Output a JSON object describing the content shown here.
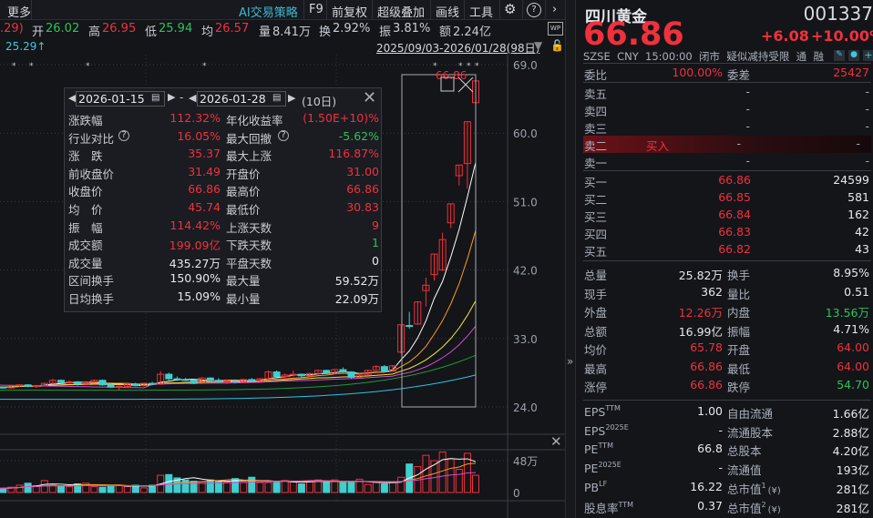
{
  "toolbar": {
    "more": "更多",
    "ai": "AI交易策略",
    "f9": "F9",
    "adjust": "前复权",
    "overlay": "超级叠加",
    "draw": "画线",
    "tools": "工具"
  },
  "quote": {
    "prev_fragment": ".29)",
    "open_label": "开",
    "open": "26.02",
    "high_label": "高",
    "high": "26.95",
    "low_label": "低",
    "low": "25.94",
    "avg_label": "均",
    "avg": "26.57",
    "vol_label": "量",
    "vol": "8.41万",
    "turn_label": "换",
    "turn": "2.92%",
    "amp_label": "振",
    "amp": "3.81%",
    "amt_label": "额",
    "amt": "2.24亿"
  },
  "range": {
    "ma_value": "25.29↑",
    "date_range": "2025/09/03-2026/01/28(98日)"
  },
  "price_axis": [
    "69.0",
    "60.0",
    "51.0",
    "42.0",
    "33.0",
    "24.0"
  ],
  "volume_axis": [
    "48万",
    "0"
  ],
  "selection": {
    "top_label": "66.86"
  },
  "popup": {
    "start": "2026-01-15",
    "end": "2026-01-28",
    "days": "(10日)",
    "rows": [
      [
        "涨跌幅",
        "112.32%",
        "年化收益率",
        "(1.50E+10)%"
      ],
      [
        "行业对比",
        "16.05%",
        "最大回撤",
        "-5.62%"
      ],
      [
        "涨　跌",
        "35.37",
        "最大上涨",
        "116.87%"
      ],
      [
        "前收盘价",
        "31.49",
        "开盘价",
        "31.00"
      ],
      [
        "收盘价",
        "66.86",
        "最高价",
        "66.86"
      ],
      [
        "均　价",
        "45.74",
        "最低价",
        "30.83"
      ],
      [
        "振　幅",
        "114.42%",
        "上涨天数",
        "9"
      ],
      [
        "成交额",
        "199.09亿",
        "下跌天数",
        "1"
      ],
      [
        "成交量",
        "435.27万",
        "平盘天数",
        "0"
      ],
      [
        "区间换手",
        "150.90%",
        "最大量",
        "59.52万"
      ],
      [
        "日均换手",
        "15.09%",
        "最小量",
        "22.09万"
      ]
    ]
  },
  "stock": {
    "name": "四川黄金",
    "code": "001337",
    "price": "66.86",
    "change": "+6.08",
    "change_pct": "+10.00%",
    "exchange": "SZSE",
    "currency": "CNY",
    "time": "15:00:00",
    "status": "闭市",
    "tag": "疑似减持受限",
    "tong": "通",
    "rong": "融"
  },
  "order_ratio": {
    "label": "委比",
    "value": "100.00%",
    "diff_label": "委差",
    "diff": "25427"
  },
  "asks": [
    [
      "卖五",
      "-",
      "-"
    ],
    [
      "卖四",
      "-",
      "-"
    ],
    [
      "卖三",
      "-",
      "-"
    ],
    [
      "卖二",
      "-",
      "-"
    ],
    [
      "卖一",
      "-",
      "-"
    ]
  ],
  "buy_in_label": "买入",
  "bids": [
    [
      "买一",
      "66.86",
      "24599"
    ],
    [
      "买二",
      "66.85",
      "581"
    ],
    [
      "买三",
      "66.84",
      "162"
    ],
    [
      "买四",
      "66.83",
      "42"
    ],
    [
      "买五",
      "66.82",
      "43"
    ]
  ],
  "stats": [
    [
      "总量",
      "25.82万",
      "",
      "换手",
      "8.95%",
      ""
    ],
    [
      "现手",
      "362",
      "",
      "量比",
      "0.51",
      ""
    ],
    [
      "外盘",
      "12.26万",
      "red",
      "内盘",
      "13.56万",
      "green"
    ],
    [
      "总额",
      "16.99亿",
      "",
      "振幅",
      "4.71%",
      ""
    ],
    [
      "均价",
      "65.78",
      "red",
      "开盘",
      "64.00",
      "red"
    ],
    [
      "最高",
      "66.86",
      "red",
      "最低",
      "64.00",
      "red"
    ],
    [
      "涨停",
      "66.86",
      "red",
      "跌停",
      "54.70",
      "green"
    ]
  ],
  "fundamentals": [
    [
      "EPS",
      "TTM",
      "1.00",
      "自由流通",
      "",
      "1.66亿"
    ],
    [
      "EPS",
      "2025E",
      "-",
      "流通股本",
      "",
      "2.88亿"
    ],
    [
      "PE",
      "TTM",
      "66.8",
      "总股本",
      "",
      "4.20亿"
    ],
    [
      "PE",
      "2025E",
      "-",
      "流通值",
      "",
      "193亿"
    ],
    [
      "PB",
      "LF",
      "16.22",
      "总市值",
      "1",
      "281亿"
    ],
    [
      "股息率",
      "TTM",
      "0.37",
      "总市值",
      "2",
      "281亿"
    ]
  ],
  "colors": {
    "up": "#f0313c",
    "down": "#3fcfcf",
    "ma5": "#ffffff",
    "ma10": "#ff9a1f",
    "ma20": "#f4e542",
    "ma30": "#d24bd6",
    "ma60": "#1f9a3a",
    "ma120": "#2fc3e0"
  },
  "chart_data": {
    "type": "candlestick",
    "ohlc": [
      [
        26.6,
        26.9,
        26.4,
        26.7
      ],
      [
        26.7,
        26.8,
        26.5,
        26.6
      ],
      [
        26.6,
        26.7,
        26.4,
        26.5
      ],
      [
        26.5,
        26.9,
        26.4,
        26.8
      ],
      [
        26.8,
        27.0,
        26.6,
        26.9
      ],
      [
        26.9,
        27.0,
        26.6,
        26.7
      ],
      [
        26.7,
        26.9,
        26.5,
        26.8
      ],
      [
        26.8,
        27.2,
        26.7,
        27.1
      ],
      [
        27.1,
        27.7,
        27.0,
        27.5
      ],
      [
        27.5,
        27.6,
        27.0,
        27.2
      ],
      [
        27.2,
        27.5,
        27.0,
        27.3
      ],
      [
        27.3,
        27.4,
        26.8,
        27.0
      ],
      [
        27.0,
        27.4,
        26.9,
        27.3
      ],
      [
        27.3,
        27.6,
        27.2,
        27.5
      ],
      [
        27.5,
        27.6,
        26.8,
        26.9
      ],
      [
        26.9,
        27.1,
        26.5,
        26.6
      ],
      [
        26.6,
        26.8,
        26.2,
        26.7
      ],
      [
        26.7,
        27.2,
        26.6,
        27.0
      ],
      [
        27.0,
        27.2,
        26.7,
        26.8
      ],
      [
        26.8,
        27.2,
        26.7,
        27.1
      ],
      [
        27.1,
        27.3,
        26.9,
        27.0
      ],
      [
        27.0,
        28.7,
        26.9,
        28.3
      ],
      [
        28.3,
        28.5,
        27.5,
        27.7
      ],
      [
        27.7,
        28.0,
        27.4,
        27.6
      ],
      [
        27.6,
        27.8,
        27.4,
        27.5
      ],
      [
        27.5,
        27.6,
        27.0,
        27.1
      ],
      [
        27.1,
        27.9,
        27.0,
        27.8
      ],
      [
        27.8,
        27.9,
        27.4,
        27.5
      ],
      [
        27.5,
        27.8,
        27.2,
        27.3
      ],
      [
        27.3,
        27.6,
        27.0,
        27.4
      ],
      [
        27.4,
        27.6,
        27.1,
        27.3
      ],
      [
        27.3,
        27.7,
        27.1,
        27.6
      ],
      [
        27.6,
        27.8,
        27.3,
        27.4
      ],
      [
        27.4,
        27.8,
        27.3,
        27.7
      ],
      [
        27.7,
        28.8,
        27.6,
        28.6
      ],
      [
        28.6,
        28.8,
        27.9,
        28.0
      ],
      [
        28.0,
        28.4,
        27.7,
        28.2
      ],
      [
        28.2,
        28.8,
        28.0,
        28.3
      ],
      [
        28.3,
        28.4,
        27.9,
        28.1
      ],
      [
        28.1,
        28.5,
        28.0,
        28.4
      ],
      [
        28.4,
        28.9,
        28.2,
        28.8
      ],
      [
        28.8,
        28.9,
        28.3,
        28.4
      ],
      [
        28.4,
        29.0,
        28.3,
        28.9
      ],
      [
        28.9,
        29.2,
        28.5,
        28.6
      ],
      [
        28.6,
        28.7,
        27.7,
        27.9
      ],
      [
        27.9,
        28.4,
        27.8,
        28.2
      ],
      [
        28.2,
        28.9,
        28.1,
        28.8
      ],
      [
        28.8,
        29.5,
        28.7,
        29.3
      ],
      [
        29.3,
        29.5,
        28.6,
        28.7
      ],
      [
        28.7,
        29.5,
        28.6,
        29.4
      ],
      [
        31.2,
        34.8,
        31.0,
        34.8
      ],
      [
        34.7,
        36.5,
        34.3,
        34.6
      ],
      [
        34.9,
        37.9,
        34.8,
        37.8
      ],
      [
        39.3,
        41.0,
        37.2,
        40.0
      ],
      [
        41.4,
        44.1,
        40.6,
        44.1
      ],
      [
        42.0,
        46.9,
        41.9,
        46.0
      ],
      [
        48.2,
        50.7,
        47.5,
        50.7
      ],
      [
        54.4,
        55.8,
        53.1,
        55.8
      ],
      [
        56.0,
        61.5,
        52.7,
        61.5
      ],
      [
        64.0,
        66.86,
        64.0,
        66.86
      ]
    ],
    "volume": [
      8,
      5,
      6,
      8,
      11,
      14,
      10,
      18,
      11,
      10,
      9,
      13,
      14,
      9,
      8,
      11,
      11,
      9,
      11,
      7,
      11,
      26,
      27,
      22,
      19,
      17,
      16,
      19,
      17,
      16,
      21,
      15,
      23,
      15,
      15,
      15,
      18,
      17,
      13,
      17,
      19,
      16,
      19,
      15,
      15,
      20,
      12,
      15,
      13,
      15,
      23,
      43,
      39,
      56,
      48,
      61,
      51,
      35,
      59,
      26
    ],
    "ylim": [
      24,
      69
    ],
    "vol_max": 48
  }
}
